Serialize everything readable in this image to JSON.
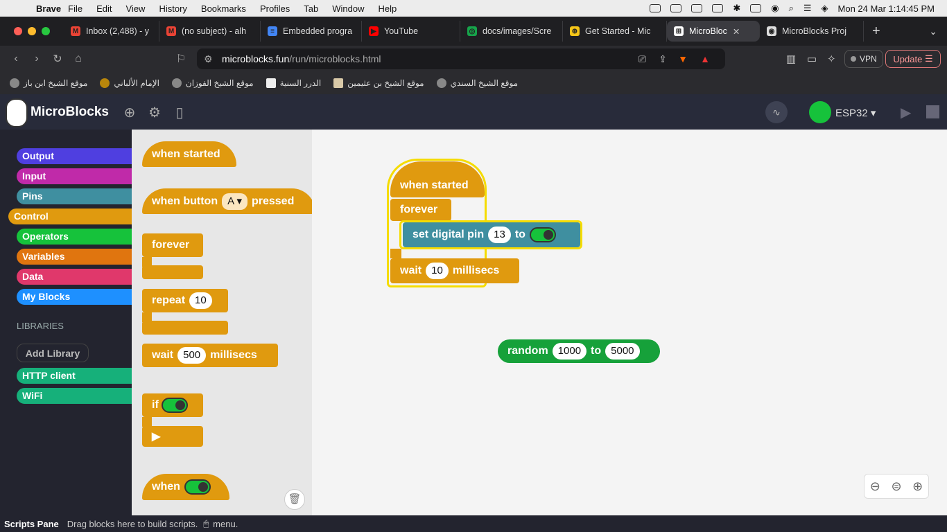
{
  "menubar": {
    "brand": "Brave",
    "items": [
      "File",
      "Edit",
      "View",
      "History",
      "Bookmarks",
      "Profiles",
      "Tab",
      "Window",
      "Help"
    ],
    "clock": "Mon 24 Mar  1:14:45 PM"
  },
  "tabs": [
    {
      "label": "Inbox (2,488) - y",
      "fav_color": "#ea4335",
      "fav_text": "M"
    },
    {
      "label": "(no subject) - alh",
      "fav_color": "#ea4335",
      "fav_text": "M"
    },
    {
      "label": "Embedded progra",
      "fav_color": "#4285f4",
      "fav_text": "≡"
    },
    {
      "label": "YouTube",
      "fav_color": "#ff0000",
      "fav_text": "▶"
    },
    {
      "label": "docs/images/Scre",
      "fav_color": "#16a34a",
      "fav_text": "◎"
    },
    {
      "label": "Get Started - Mic",
      "fav_color": "#f5c518",
      "fav_text": "⊕"
    },
    {
      "label": "MicroBloc",
      "fav_color": "#ffffff",
      "fav_text": "⊞"
    },
    {
      "label": "MicroBlocks Proj",
      "fav_color": "#dddddd",
      "fav_text": "◉"
    }
  ],
  "active_tab": 6,
  "address": {
    "host": "microblocks.fun",
    "path": "/run/microblocks.html"
  },
  "toolbar": {
    "vpn": "VPN",
    "update": "Update"
  },
  "bookmarks": [
    "موقع الشيخ ابن باز",
    "الإمام الألباني",
    "موقع الشيخ الفوزان",
    "الدرر السنية",
    "موقع الشيخ بن عثيمين",
    "موقع الشيخ السندي"
  ],
  "app": {
    "title": "MicroBlocks",
    "board": "ESP32"
  },
  "categories": [
    {
      "label": "Output",
      "color": "#4f3fe0"
    },
    {
      "label": "Input",
      "color": "#c02aa9"
    },
    {
      "label": "Pins",
      "color": "#3f8fa0"
    },
    {
      "label": "Control",
      "color": "#e09a0f"
    },
    {
      "label": "Operators",
      "color": "#16c23b"
    },
    {
      "label": "Variables",
      "color": "#e0750f"
    },
    {
      "label": "Data",
      "color": "#e0386b"
    },
    {
      "label": "My Blocks",
      "color": "#1e90ff"
    }
  ],
  "libraries": {
    "header": "LIBRARIES",
    "add": "Add Library",
    "items": [
      {
        "label": "HTTP client",
        "color": "#16b07a"
      },
      {
        "label": "WiFi",
        "color": "#16b07a"
      }
    ]
  },
  "palette": {
    "when_started": "when started",
    "when_button": "when button",
    "button_val": "A",
    "pressed": "pressed",
    "forever": "forever",
    "repeat": "repeat",
    "repeat_val": "10",
    "wait": "wait",
    "wait_val": "500",
    "millisecs": "millisecs",
    "if": "if",
    "when": "when"
  },
  "script": {
    "when_started": "when started",
    "forever": "forever",
    "set_digital_pin": "set digital pin",
    "pin": "13",
    "to": "to",
    "wait": "wait",
    "wait_val": "10",
    "millisecs": "millisecs"
  },
  "random": {
    "label": "random",
    "from": "1000",
    "to_label": "to",
    "to": "5000"
  },
  "status": {
    "title": "Scripts Pane",
    "text": "Drag blocks here to build scripts.",
    "menu": "menu."
  }
}
